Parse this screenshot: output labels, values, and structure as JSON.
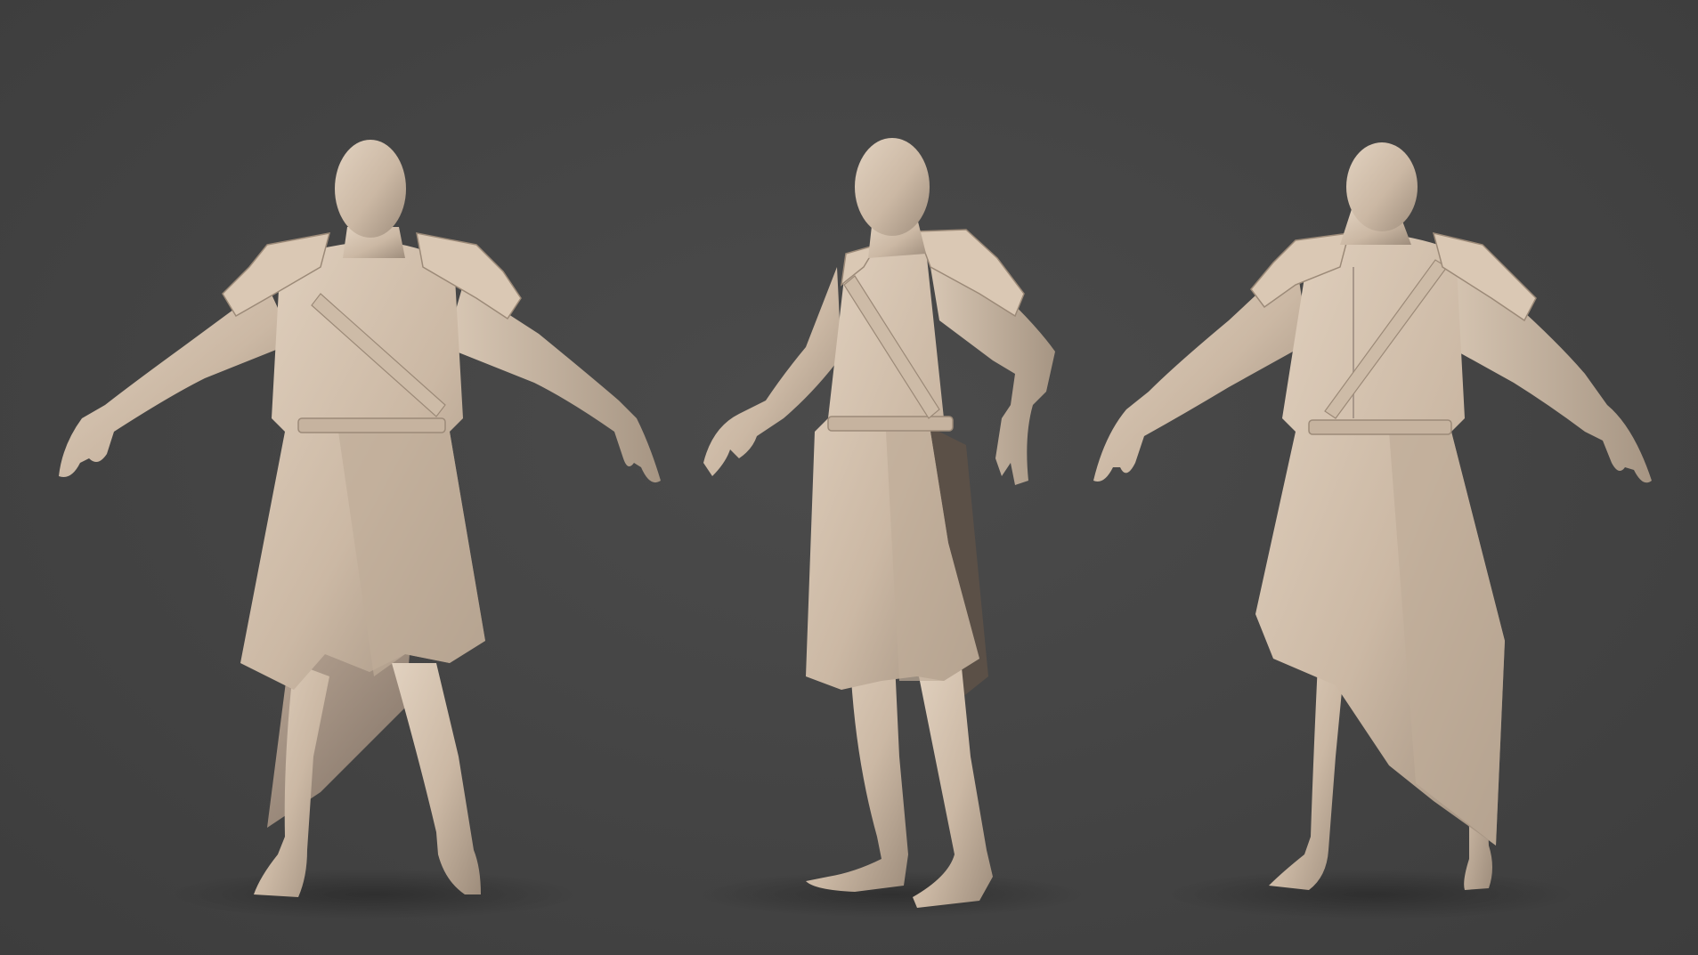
{
  "scene": {
    "background_color": "#454545",
    "material_color": "#d3c1ae",
    "figures": [
      {
        "view": "front",
        "pose": "a-pose"
      },
      {
        "view": "three-quarter",
        "pose": "a-pose"
      },
      {
        "view": "back",
        "pose": "a-pose"
      }
    ]
  }
}
